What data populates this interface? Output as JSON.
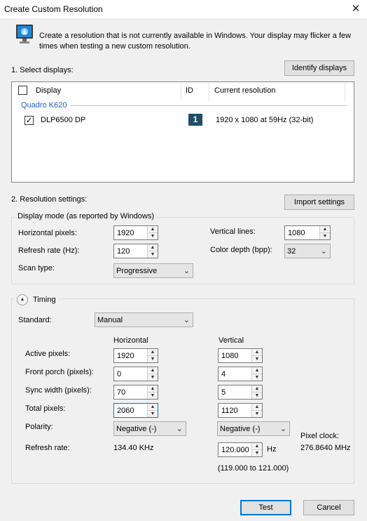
{
  "window": {
    "title": "Create Custom Resolution",
    "close_glyph": "✕"
  },
  "intro_text": "Create a resolution that is not currently available in Windows. Your display may flicker a few times when testing a new custom resolution.",
  "select_displays": {
    "heading": "1. Select displays:",
    "identify_button": "Identify displays",
    "columns": {
      "display": "Display",
      "id": "ID",
      "current_resolution": "Current resolution"
    },
    "gpu_group": "Quadro K620",
    "rows": [
      {
        "checked": true,
        "check_glyph": "✓",
        "name": "DLP6500 DP",
        "id": "1",
        "resolution": "1920 x 1080 at 59Hz (32-bit)"
      }
    ]
  },
  "resolution_settings": {
    "heading": "2. Resolution settings:",
    "import_button": "Import settings",
    "display_mode": {
      "legend": "Display mode (as reported by Windows)",
      "horizontal_pixels_label": "Horizontal pixels:",
      "horizontal_pixels": "1920",
      "vertical_lines_label": "Vertical lines:",
      "vertical_lines": "1080",
      "refresh_rate_label": "Refresh rate (Hz):",
      "refresh_rate": "120",
      "color_depth_label": "Color depth (bpp):",
      "color_depth": "32",
      "scan_type_label": "Scan type:",
      "scan_type": "Progressive"
    },
    "timing": {
      "legend": "Timing",
      "standard_label": "Standard:",
      "standard": "Manual",
      "horizontal_header": "Horizontal",
      "vertical_header": "Vertical",
      "active_pixels_label": "Active pixels:",
      "front_porch_label": "Front porch (pixels):",
      "sync_width_label": "Sync width (pixels):",
      "total_pixels_label": "Total pixels:",
      "polarity_label": "Polarity:",
      "refresh_rate_label": "Refresh rate:",
      "horizontal": {
        "active": "1920",
        "front_porch": "0",
        "sync_width": "70",
        "total": "2060",
        "polarity": "Negative (-)",
        "refresh": "134.40 KHz"
      },
      "vertical": {
        "active": "1080",
        "front_porch": "4",
        "sync_width": "5",
        "total": "1120",
        "polarity": "Negative (-)",
        "refresh": "120.000",
        "refresh_unit": "Hz",
        "refresh_range": "(119.000 to 121.000)"
      },
      "pixel_clock_label": "Pixel clock:",
      "pixel_clock": "276.8640 MHz"
    }
  },
  "buttons": {
    "test": "Test",
    "cancel": "Cancel"
  },
  "icons": {
    "spin_up": "▲",
    "spin_down": "▼",
    "dropdown": "⌄",
    "collapse": "▲"
  }
}
